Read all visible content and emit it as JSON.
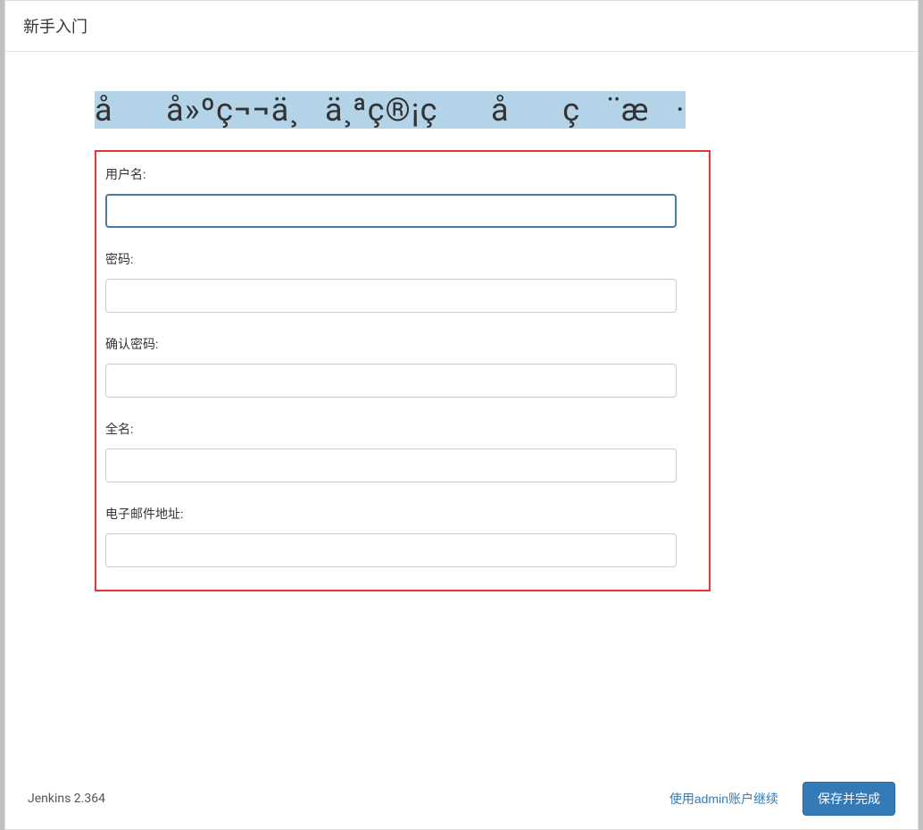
{
  "header": {
    "title": "新手入门"
  },
  "main": {
    "heading": "åå»ºç¬¬ä¸ä¸ªç®¡çåç¨æ·"
  },
  "form": {
    "username": {
      "label": "用户名:",
      "value": ""
    },
    "password": {
      "label": "密码:",
      "value": ""
    },
    "confirm_password": {
      "label": "确认密码:",
      "value": ""
    },
    "fullname": {
      "label": "全名:",
      "value": ""
    },
    "email": {
      "label": "电子邮件地址:",
      "value": ""
    }
  },
  "footer": {
    "version": "Jenkins 2.364",
    "continue_as_admin": "使用admin账户继续",
    "save_and_finish": "保存并完成"
  }
}
